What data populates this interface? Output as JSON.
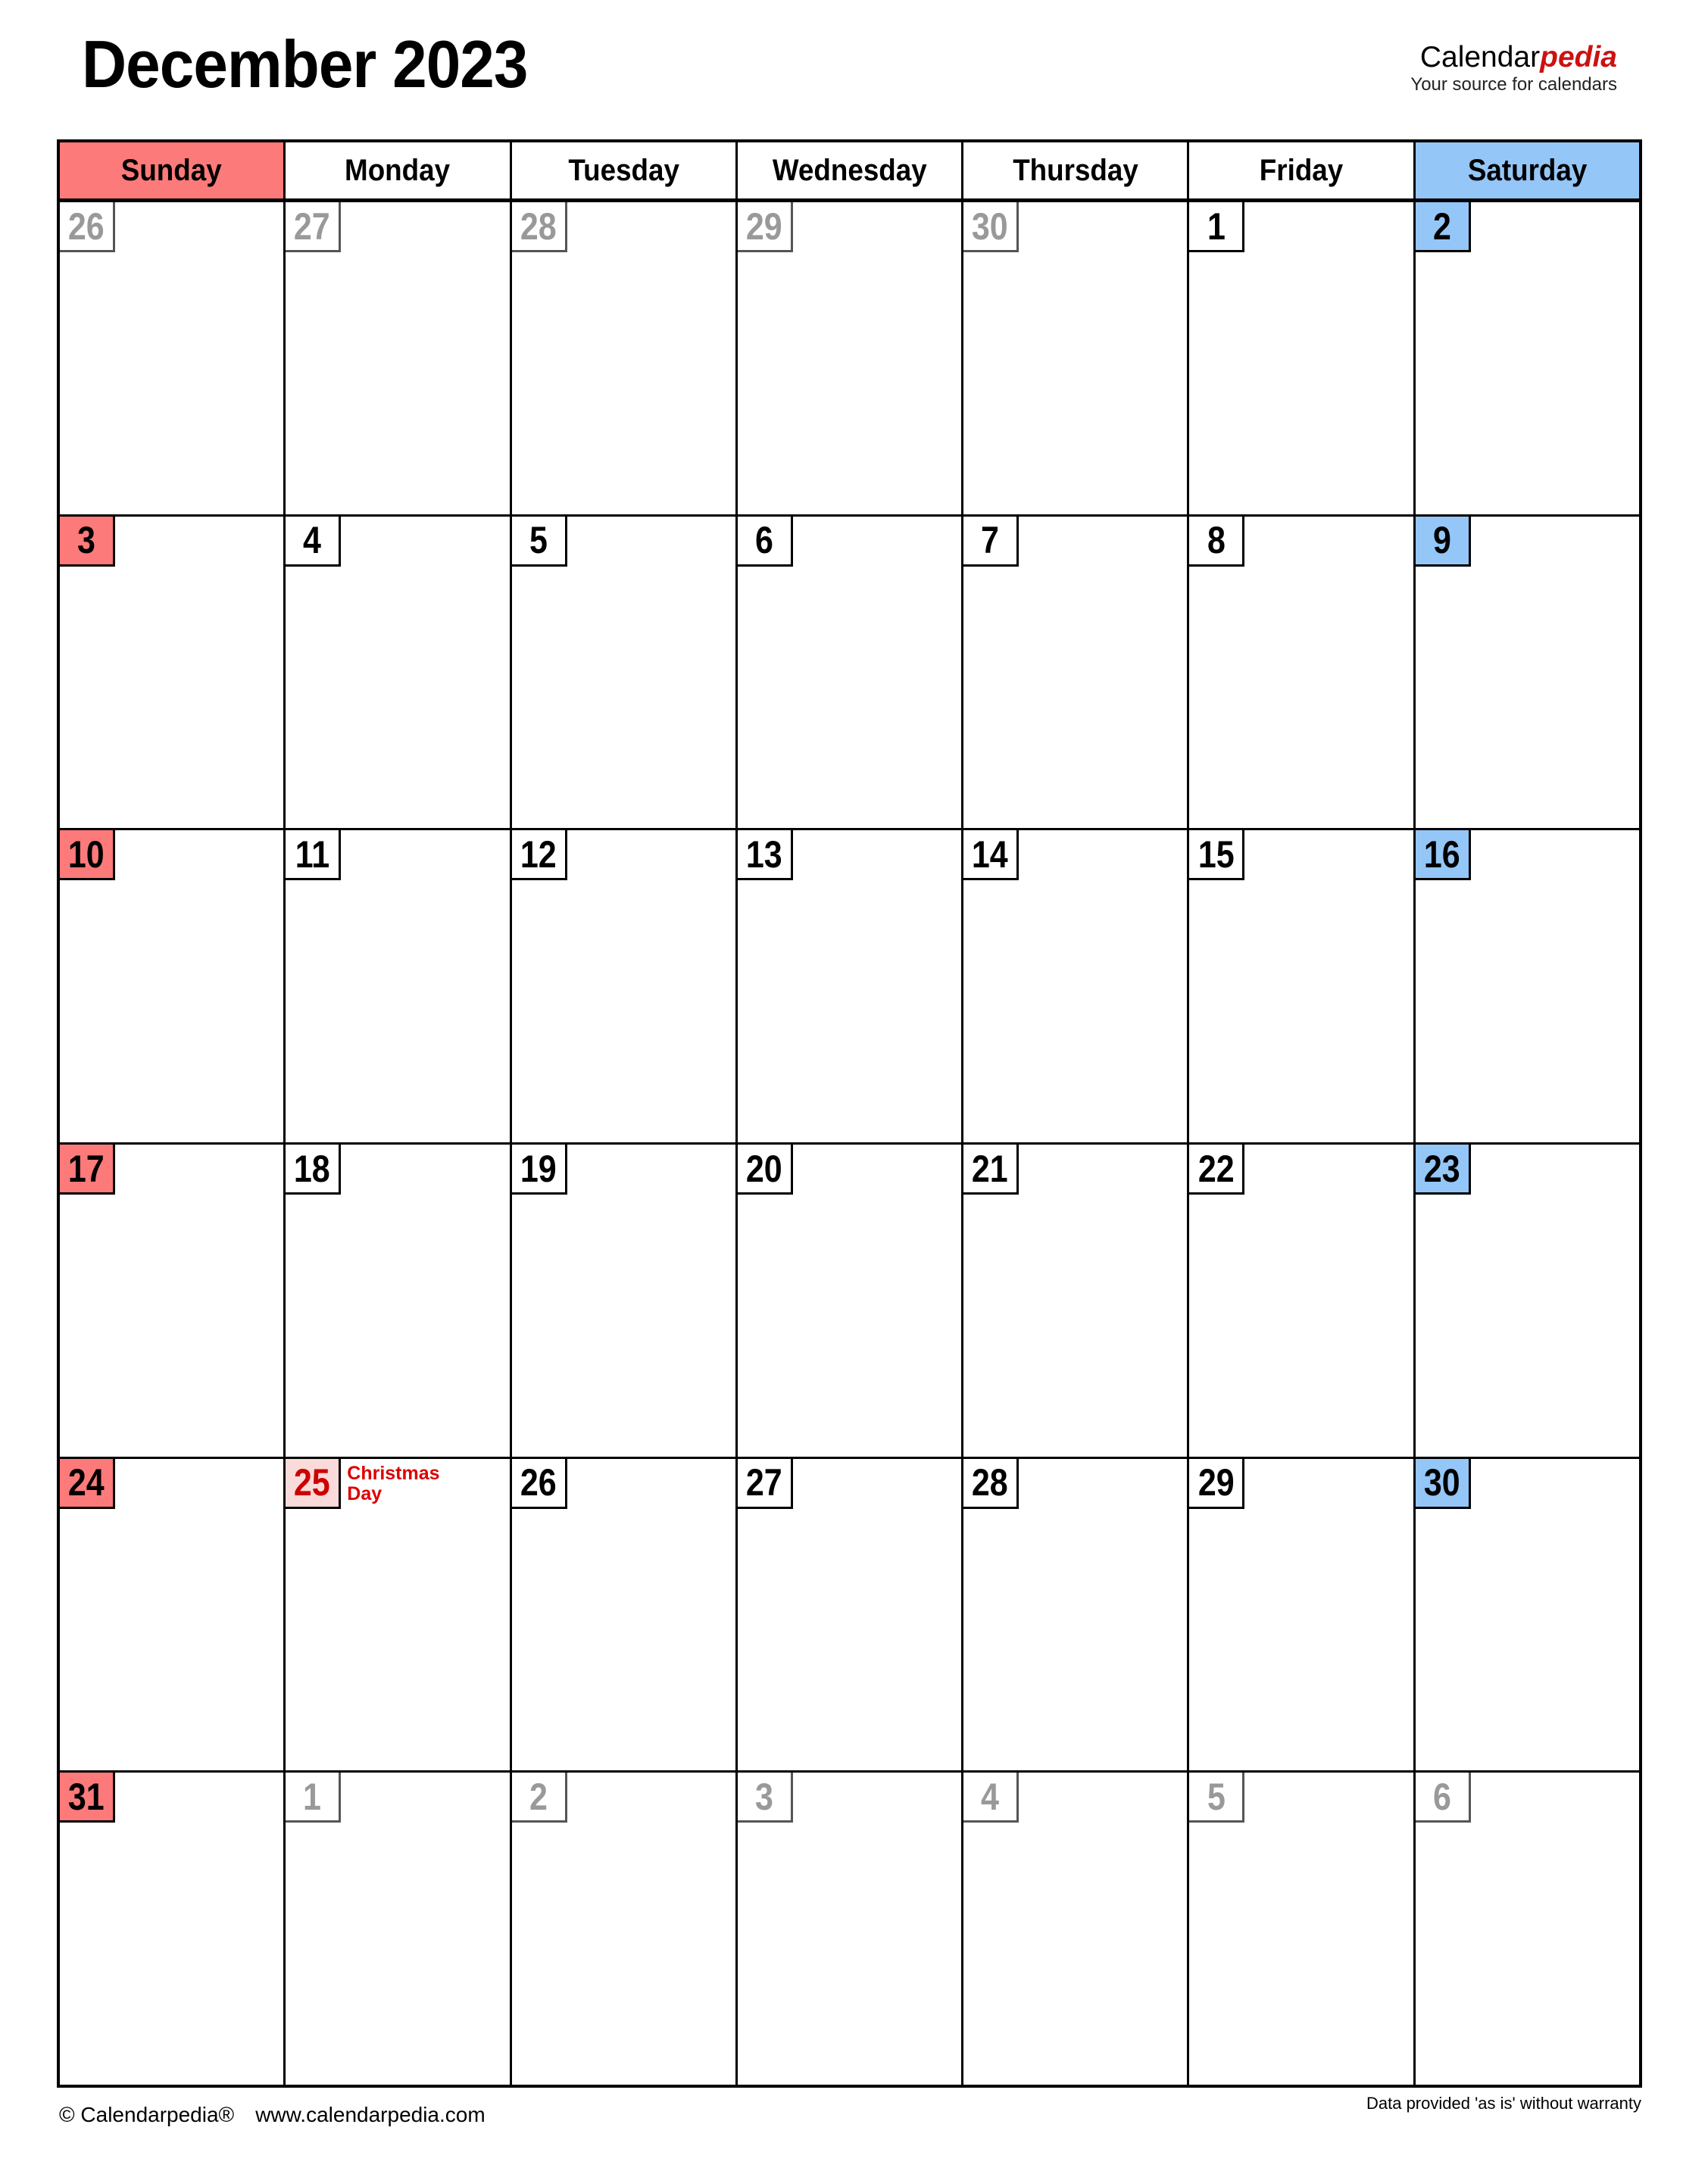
{
  "header": {
    "month_title": "December 2023",
    "brand_main_black": "Calendar",
    "brand_main_red": "pedia",
    "brand_tagline": "Your source for calendars"
  },
  "colors": {
    "sunday_bg": "#fc7a7a",
    "saturday_bg": "#94c6f7",
    "holiday_bg": "#fbdada",
    "holiday_text": "#cc0000",
    "other_month_text": "#999999",
    "brand_red": "#cc1111"
  },
  "weekdays": [
    {
      "label": "Sunday",
      "kind": "sunday"
    },
    {
      "label": "Monday",
      "kind": "weekday"
    },
    {
      "label": "Tuesday",
      "kind": "weekday"
    },
    {
      "label": "Wednesday",
      "kind": "weekday"
    },
    {
      "label": "Thursday",
      "kind": "weekday"
    },
    {
      "label": "Friday",
      "kind": "weekday"
    },
    {
      "label": "Saturday",
      "kind": "saturday"
    }
  ],
  "weeks": [
    [
      {
        "day": "26",
        "month": "prev",
        "event": ""
      },
      {
        "day": "27",
        "month": "prev",
        "event": ""
      },
      {
        "day": "28",
        "month": "prev",
        "event": ""
      },
      {
        "day": "29",
        "month": "prev",
        "event": ""
      },
      {
        "day": "30",
        "month": "prev",
        "event": ""
      },
      {
        "day": "1",
        "month": "current",
        "event": ""
      },
      {
        "day": "2",
        "month": "current",
        "event": ""
      }
    ],
    [
      {
        "day": "3",
        "month": "current",
        "event": ""
      },
      {
        "day": "4",
        "month": "current",
        "event": ""
      },
      {
        "day": "5",
        "month": "current",
        "event": ""
      },
      {
        "day": "6",
        "month": "current",
        "event": ""
      },
      {
        "day": "7",
        "month": "current",
        "event": ""
      },
      {
        "day": "8",
        "month": "current",
        "event": ""
      },
      {
        "day": "9",
        "month": "current",
        "event": ""
      }
    ],
    [
      {
        "day": "10",
        "month": "current",
        "event": ""
      },
      {
        "day": "11",
        "month": "current",
        "event": ""
      },
      {
        "day": "12",
        "month": "current",
        "event": ""
      },
      {
        "day": "13",
        "month": "current",
        "event": ""
      },
      {
        "day": "14",
        "month": "current",
        "event": ""
      },
      {
        "day": "15",
        "month": "current",
        "event": ""
      },
      {
        "day": "16",
        "month": "current",
        "event": ""
      }
    ],
    [
      {
        "day": "17",
        "month": "current",
        "event": ""
      },
      {
        "day": "18",
        "month": "current",
        "event": ""
      },
      {
        "day": "19",
        "month": "current",
        "event": ""
      },
      {
        "day": "20",
        "month": "current",
        "event": ""
      },
      {
        "day": "21",
        "month": "current",
        "event": ""
      },
      {
        "day": "22",
        "month": "current",
        "event": ""
      },
      {
        "day": "23",
        "month": "current",
        "event": ""
      }
    ],
    [
      {
        "day": "24",
        "month": "current",
        "event": ""
      },
      {
        "day": "25",
        "month": "current",
        "event": "Christmas Day",
        "holiday": true
      },
      {
        "day": "26",
        "month": "current",
        "event": ""
      },
      {
        "day": "27",
        "month": "current",
        "event": ""
      },
      {
        "day": "28",
        "month": "current",
        "event": ""
      },
      {
        "day": "29",
        "month": "current",
        "event": ""
      },
      {
        "day": "30",
        "month": "current",
        "event": ""
      }
    ],
    [
      {
        "day": "31",
        "month": "current",
        "event": ""
      },
      {
        "day": "1",
        "month": "next",
        "event": ""
      },
      {
        "day": "2",
        "month": "next",
        "event": ""
      },
      {
        "day": "3",
        "month": "next",
        "event": ""
      },
      {
        "day": "4",
        "month": "next",
        "event": ""
      },
      {
        "day": "5",
        "month": "next",
        "event": ""
      },
      {
        "day": "6",
        "month": "next",
        "event": ""
      }
    ]
  ],
  "footer": {
    "copyright": "© Calendarpedia®",
    "url": "www.calendarpedia.com",
    "disclaimer": "Data provided 'as is' without warranty"
  }
}
